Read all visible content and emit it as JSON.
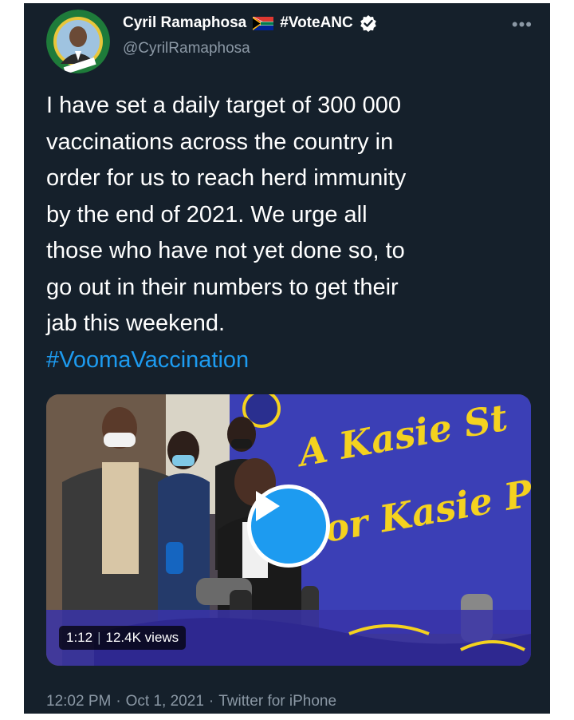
{
  "tweet": {
    "author_name": "Cyril Ramaphosa",
    "author_tag": "#VoteANC",
    "handle": "@CyrilRamaphosa",
    "avatar_ring_text": "REGISTERED TO VOTE ANC",
    "more_label": "•••",
    "text": "I have set a daily target of 300 000\nvaccinations across the country in\norder for us to reach herd immunity\nby the end of 2021. We urge all\nthose who have not yet done so, to\ngo out in their numbers to get their\njab this weekend.",
    "hashtag": "#VoomaVaccination",
    "video": {
      "duration": "1:12",
      "views": "12.4K views",
      "banner_line1": "A Kasie St",
      "banner_line2": "or Kasie P"
    },
    "time": "12:02 PM",
    "date": "Oct 1, 2021",
    "source": "Twitter for iPhone",
    "dot": "·"
  },
  "colors": {
    "background": "#15202b",
    "accent": "#1d9bf0",
    "secondary_text": "#8b98a5",
    "banner_blue": "#3b3fb6",
    "banner_yellow": "#f4d21f"
  },
  "icons": [
    "sa-flag-icon",
    "verified-icon",
    "more-icon",
    "play-icon"
  ]
}
